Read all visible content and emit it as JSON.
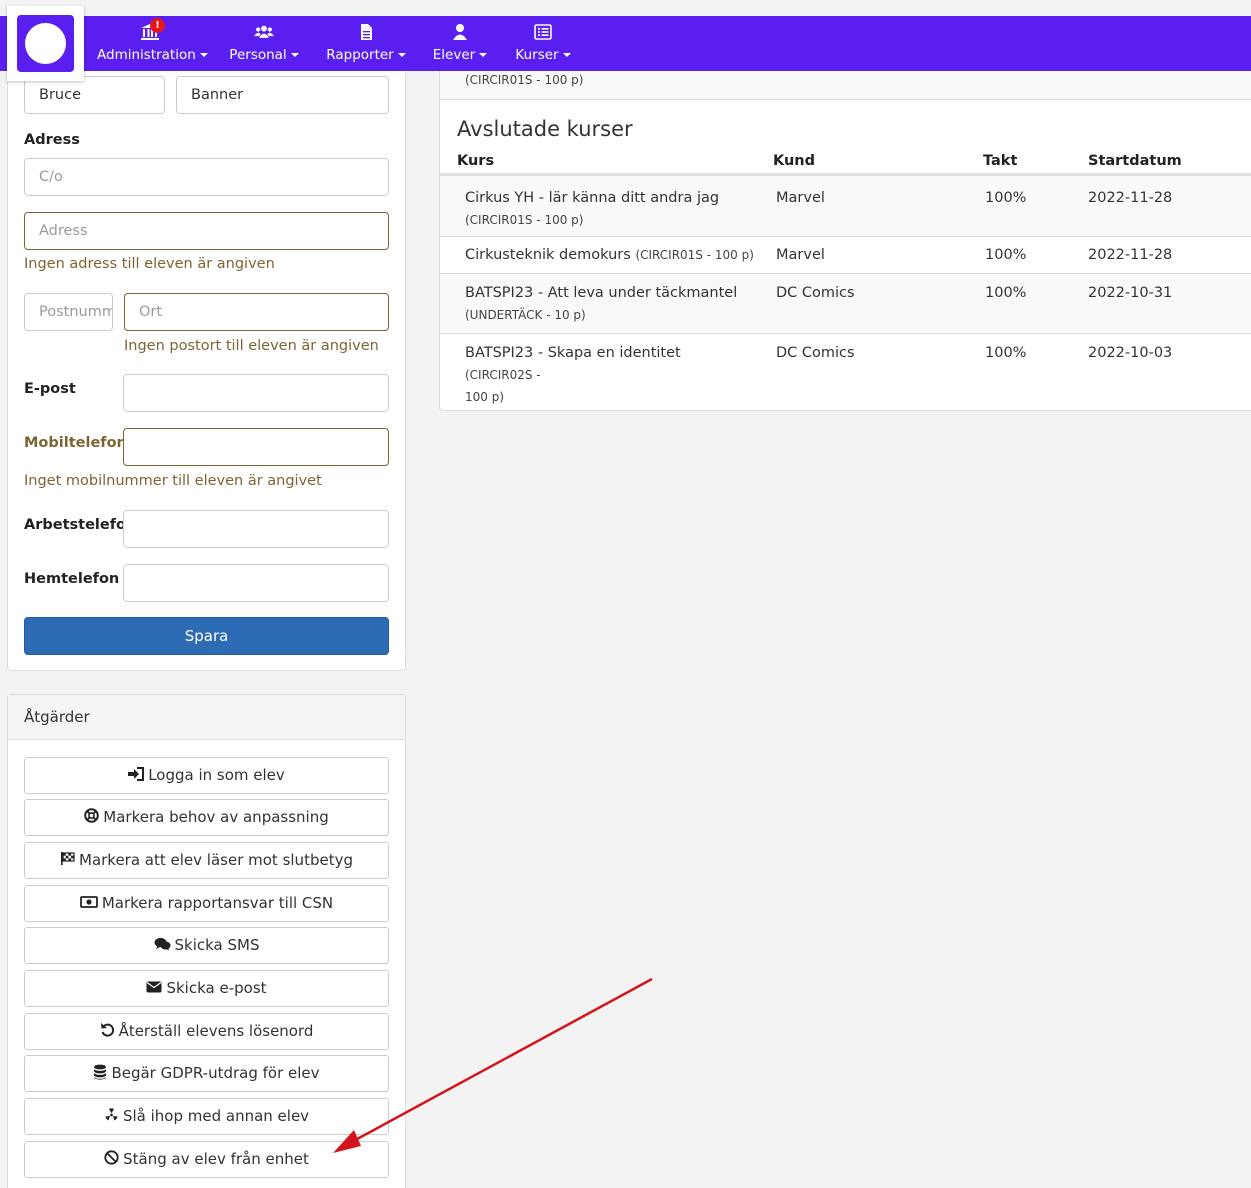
{
  "nav": {
    "items": [
      {
        "label": "Administration",
        "icon": "bank-icon",
        "badge": "!"
      },
      {
        "label": "Personal",
        "icon": "users-icon"
      },
      {
        "label": "Rapporter",
        "icon": "file-icon"
      },
      {
        "label": "Elever",
        "icon": "user-icon"
      },
      {
        "label": "Kurser",
        "icon": "list-icon"
      }
    ],
    "accent": "#5b1ef0"
  },
  "form": {
    "first_name": "Bruce",
    "last_name": "Banner",
    "address_label": "Adress",
    "co_placeholder": "C/o",
    "address_placeholder": "Adress",
    "address_warning": "Ingen adress till eleven är angiven",
    "postnr_placeholder": "Postnummer",
    "ort_placeholder": "Ort",
    "ort_warning": "Ingen postort till eleven är angiven",
    "email_label": "E-post",
    "mobile_label": "Mobiltelefon",
    "mobile_warning": "Inget mobilnummer till eleven är angivet",
    "work_phone_label": "Arbetstelefon",
    "home_phone_label": "Hemtelefon",
    "save_label": "Spara"
  },
  "actions": {
    "title": "Åtgärder",
    "buttons": [
      {
        "label": "Logga in som elev",
        "icon": "sign-in-icon"
      },
      {
        "label": "Markera behov av anpassning",
        "icon": "life-ring-icon"
      },
      {
        "label": "Markera att elev läser mot slutbetyg",
        "icon": "checkered-flag-icon"
      },
      {
        "label": "Markera rapportansvar till CSN",
        "icon": "money-icon"
      },
      {
        "label": "Skicka SMS",
        "icon": "chat-icon"
      },
      {
        "label": "Skicka e-post",
        "icon": "envelope-icon"
      },
      {
        "label": "Återställ elevens lösenord",
        "icon": "undo-icon"
      },
      {
        "label": "Begär GDPR-utdrag för elev",
        "icon": "database-icon"
      },
      {
        "label": "Slå ihop med annan elev",
        "icon": "radiation-icon"
      },
      {
        "label": "Stäng av elev från enhet",
        "icon": "ban-icon"
      }
    ]
  },
  "courses": {
    "top_row_text": "(CIRCIR01S - 100 p)",
    "completed_title": "Avslutade kurser",
    "headers": [
      "Kurs",
      "Kund",
      "Takt",
      "Startdatum"
    ],
    "rows": [
      {
        "course": "Cirkus YH - lär känna ditt andra jag",
        "code": "(CIRCIR01S - 100 p)",
        "customer": "Marvel",
        "pace": "100%",
        "start": "2022-11-28"
      },
      {
        "course": "Cirkusteknik demokurs",
        "code": "(CIRCIR01S - 100 p)",
        "customer": "Marvel",
        "pace": "100%",
        "start": "2022-11-28"
      },
      {
        "course": "BATSPI23 - Att leva under täckmantel",
        "code": "(UNDERTÄCK - 10 p)",
        "customer": "DC Comics",
        "pace": "100%",
        "start": "2022-10-31"
      },
      {
        "course": "BATSPI23 - Skapa en identitet",
        "code": "(CIRCIR02S -",
        "code2": "100 p)",
        "customer": "DC Comics",
        "pace": "100%",
        "start": "2022-10-03"
      }
    ]
  }
}
